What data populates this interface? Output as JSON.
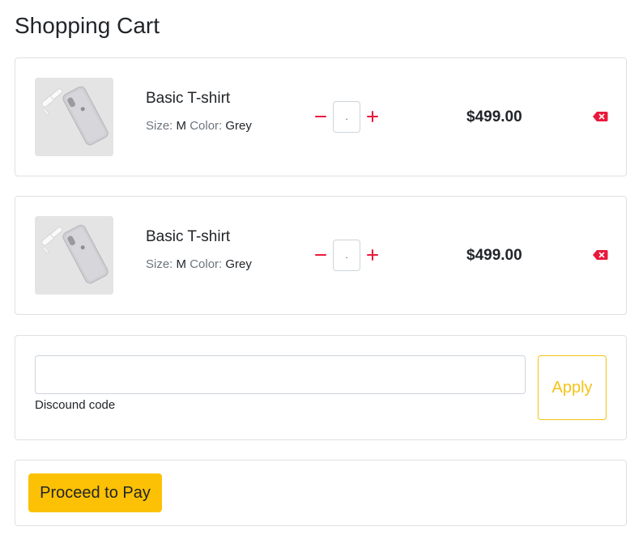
{
  "page": {
    "title": "Shopping Cart"
  },
  "colors": {
    "accent": "#fcc104",
    "accent_outline": "#f5c216",
    "danger": "#e9193c",
    "border": "#dfe0e2",
    "muted_text": "#6c757d"
  },
  "cart": {
    "items": [
      {
        "name": "Basic T-shirt",
        "size_label": "Size:",
        "size_value": "M",
        "color_label": "Color:",
        "color_value": "Grey",
        "quantity": ".",
        "price": "$499.00",
        "image_icon": "phone-product-image",
        "decrement_icon": "minus-icon",
        "increment_icon": "plus-icon",
        "remove_icon": "backspace-delete-icon"
      },
      {
        "name": "Basic T-shirt",
        "size_label": "Size:",
        "size_value": "M",
        "color_label": "Color:",
        "color_value": "Grey",
        "quantity": ".",
        "price": "$499.00",
        "image_icon": "phone-product-image",
        "decrement_icon": "minus-icon",
        "increment_icon": "plus-icon",
        "remove_icon": "backspace-delete-icon"
      }
    ]
  },
  "discount": {
    "input_value": "",
    "label": "Discound code",
    "apply_label": "Apply"
  },
  "checkout": {
    "pay_label": "Proceed to Pay"
  }
}
